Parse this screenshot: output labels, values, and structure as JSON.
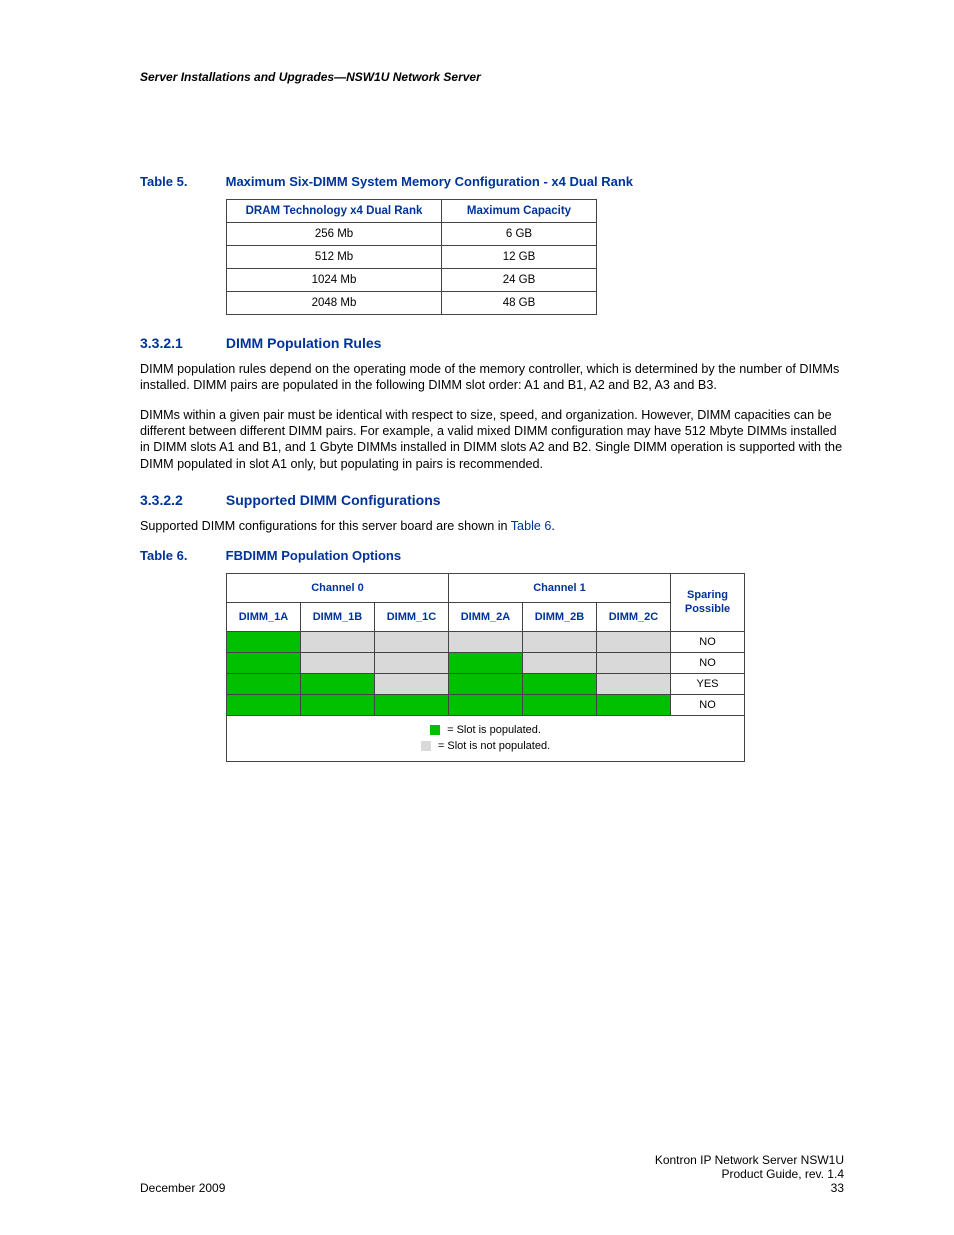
{
  "header": {
    "running": "Server Installations and Upgrades—NSW1U Network Server"
  },
  "table5": {
    "caption_label": "Table 5.",
    "caption_title": "Maximum Six-DIMM System Memory Configuration - x4 Dual Rank",
    "head_tech": "DRAM Technology x4 Dual Rank",
    "head_cap": "Maximum Capacity",
    "rows": [
      {
        "tech": "256 Mb",
        "cap": "6 GB"
      },
      {
        "tech": "512 Mb",
        "cap": "12 GB"
      },
      {
        "tech": "1024 Mb",
        "cap": "24 GB"
      },
      {
        "tech": "2048 Mb",
        "cap": "48 GB"
      }
    ]
  },
  "sec3321": {
    "num": "3.3.2.1",
    "title": "DIMM Population Rules",
    "p1": "DIMM population rules depend on the operating mode of the memory controller, which is determined by the number of DIMMs installed. DIMM pairs are populated in the following DIMM slot order: A1 and B1, A2 and B2, A3 and B3.",
    "p2": "DIMMs within a given pair must be identical with respect to size, speed, and organization. However, DIMM capacities can be different between different DIMM pairs. For example, a valid mixed DIMM configuration may have 512 Mbyte DIMMs installed in DIMM slots A1 and B1, and 1 Gbyte DIMMs installed in DIMM slots A2 and B2. Single DIMM operation is supported with the DIMM populated in slot A1 only, but populating in pairs is recommended."
  },
  "sec3322": {
    "num": "3.3.2.2",
    "title": "Supported DIMM Configurations",
    "p_prefix": "Supported DIMM configurations for this server board are shown in ",
    "p_link": "Table 6",
    "p_suffix": "."
  },
  "table6": {
    "caption_label": "Table 6.",
    "caption_title": "FBDIMM Population Options",
    "group0": "Channel 0",
    "group1": "Channel 1",
    "sparing_top": "Sparing",
    "sparing_bot": "Possible",
    "cols": {
      "d1a": "DIMM_1A",
      "d1b": "DIMM_1B",
      "d1c": "DIMM_1C",
      "d2a": "DIMM_2A",
      "d2b": "DIMM_2B",
      "d2c": "DIMM_2C"
    },
    "rows": [
      {
        "d1a": "green",
        "d1b": "grey",
        "d1c": "grey",
        "d2a": "grey",
        "d2b": "grey",
        "d2c": "grey",
        "sp": "NO"
      },
      {
        "d1a": "green",
        "d1b": "grey",
        "d1c": "grey",
        "d2a": "green",
        "d2b": "grey",
        "d2c": "grey",
        "sp": "NO"
      },
      {
        "d1a": "green",
        "d1b": "green",
        "d1c": "grey",
        "d2a": "green",
        "d2b": "green",
        "d2c": "grey",
        "sp": "YES"
      },
      {
        "d1a": "green",
        "d1b": "green",
        "d1c": "green",
        "d2a": "green",
        "d2b": "green",
        "d2c": "green",
        "sp": "NO"
      }
    ],
    "legend_pop": "= Slot is populated.",
    "legend_not": "= Slot is not populated."
  },
  "footer": {
    "left": "December 2009",
    "r1": "Kontron IP Network Server NSW1U",
    "r2": "Product Guide, rev. 1.4",
    "r3": "33"
  }
}
